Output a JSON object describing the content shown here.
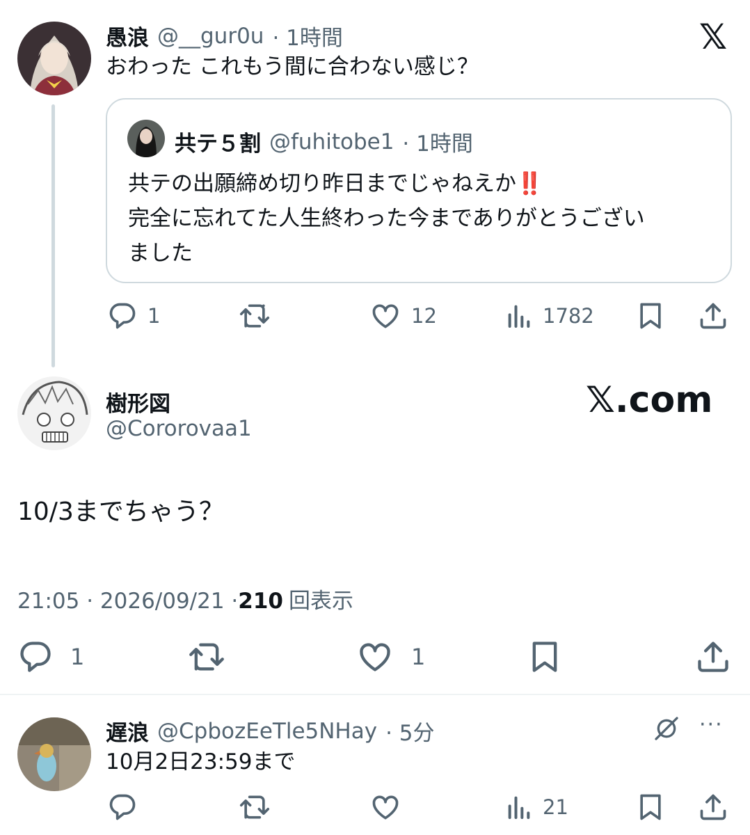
{
  "top_tweet": {
    "name": "愚浪",
    "handle": "@__gur0u",
    "time": "· 1時間",
    "text": "おわった これもう間に合わない感じ？",
    "quote": {
      "name": "共テ５割",
      "handle": "@fuhitobe1",
      "time": "· 1時間",
      "lines": [
        "共テの出願締め切り昨日までじゃねえか‼️",
        "完全に忘れてた人生終わった今までありがとうござい",
        "ました"
      ]
    },
    "actions": {
      "reply": "1",
      "like": "12",
      "views": "1782"
    }
  },
  "main_tweet": {
    "name": "樹形図",
    "handle": "@Cororovaa1",
    "text": "10/3までちゃう？",
    "meta_time": "21:05 · 2026/09/21 · ",
    "meta_views": "210",
    "meta_views_label": "回表示",
    "actions": {
      "reply": "1",
      "like": "1"
    }
  },
  "brand": {
    "x_logo": "𝕏",
    "watermark": "𝕏.com"
  },
  "reply_tweet": {
    "name": "遅浪",
    "handle": "@CpbozEeTle5NHay",
    "time": "· 5分",
    "text": "10月2日23:59まで",
    "more": "···",
    "actions": {
      "views": "21"
    }
  },
  "icons": [
    "reply-icon",
    "retweet-icon",
    "like-icon",
    "views-icon",
    "bookmark-icon",
    "share-icon",
    "grok-icon",
    "x-logo-icon"
  ],
  "colors": {
    "text": "#0f1419",
    "muted": "#536471",
    "border": "#cfd9de",
    "divider": "#eff3f4"
  }
}
